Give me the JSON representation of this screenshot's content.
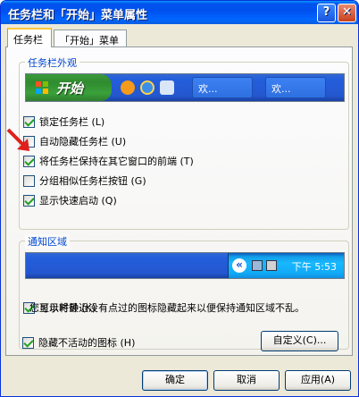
{
  "window": {
    "title": "任务栏和「开始」菜单属性",
    "help_glyph": "?",
    "close_glyph": "✕"
  },
  "tabs": [
    {
      "label": "任务栏",
      "active": true
    },
    {
      "label": "「开始」菜单",
      "active": false
    }
  ],
  "appearance_group": {
    "title": "任务栏外观",
    "taskbar_preview": {
      "start_label": "开始",
      "task_buttons": [
        "欢...",
        "欢..."
      ]
    },
    "options": [
      {
        "label": "锁定任务栏",
        "hotkey": "(L)",
        "checked": true
      },
      {
        "label": "自动隐藏任务栏",
        "hotkey": "(U)",
        "checked": false
      },
      {
        "label": "将任务栏保持在其它窗口的前端",
        "hotkey": "(T)",
        "checked": true
      },
      {
        "label": "分组相似任务栏按钮",
        "hotkey": "(G)",
        "checked": false
      },
      {
        "label": "显示快速启动",
        "hotkey": "(Q)",
        "checked": true
      }
    ]
  },
  "notification_group": {
    "title": "通知区域",
    "tray_preview": {
      "chevron": "«",
      "clock": "下午 5:53"
    },
    "show_clock": {
      "label": "显示时钟",
      "hotkey": "(K)",
      "checked": true
    },
    "description": "您可以将最近没有点过的图标隐藏起来以便保持通知区域不乱。",
    "hide_inactive": {
      "label": "隐藏不活动的图标",
      "hotkey": "(H)",
      "checked": true
    },
    "customize_button": "自定义(C)..."
  },
  "footer": {
    "ok": "确定",
    "cancel": "取消",
    "apply": "应用(A)"
  },
  "colors": {
    "title_bar": "#0053ee",
    "dialog_bg": "#ece9d8",
    "group_title": "#0046d5",
    "arrow": "#e0201c"
  }
}
